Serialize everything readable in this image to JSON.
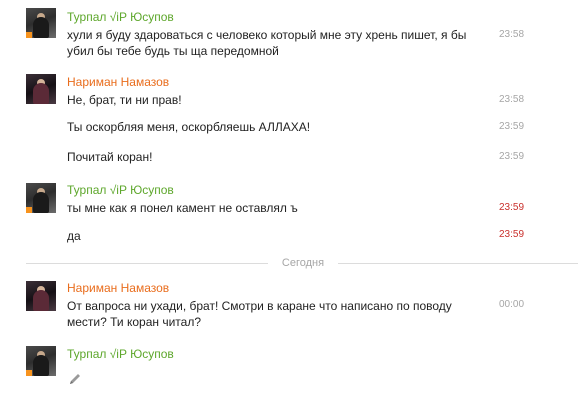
{
  "messages": [
    {
      "author": "Турпал √iP Юсупов",
      "lines": [
        {
          "text": "хули я буду здароваться с человеко который мне эту хрень пишет, я бы убил бы тебе будь ты ща передомной",
          "time": "23:58"
        }
      ]
    },
    {
      "author": "Нариман Намазов",
      "lines": [
        {
          "text": "Не, брат, ти ни прав!",
          "time": "23:58"
        },
        {
          "text": "Ты оскорбляя меня, оскорбляешь АЛЛАХА!",
          "time": "23:59"
        },
        {
          "text": "Почитай коран!",
          "time": "23:59"
        }
      ]
    },
    {
      "author": "Турпал √iP Юсупов",
      "lines": [
        {
          "text": "ты мне как я понел камент не оставлял ъ",
          "time": "23:59"
        },
        {
          "text": "да",
          "time": "23:59"
        }
      ]
    },
    {
      "author": "Нариман Намазов",
      "lines": [
        {
          "text": "От вапроса ни ухади, брат! Смотри в каране что написано по поводу мести? Ти коран читал?",
          "time": "00:00"
        }
      ]
    },
    {
      "author": "Турпал √iP Юсупов",
      "lines": []
    }
  ],
  "date_separator": "Сегодня",
  "colors": {
    "author_turpal": "#5ea72c",
    "author_nariman": "#e96d1d",
    "time_default": "#a6a6a6",
    "time_unread": "#c9302c",
    "online_indicator": "#f7931e"
  },
  "icons": {
    "edit": "pencil-icon"
  }
}
